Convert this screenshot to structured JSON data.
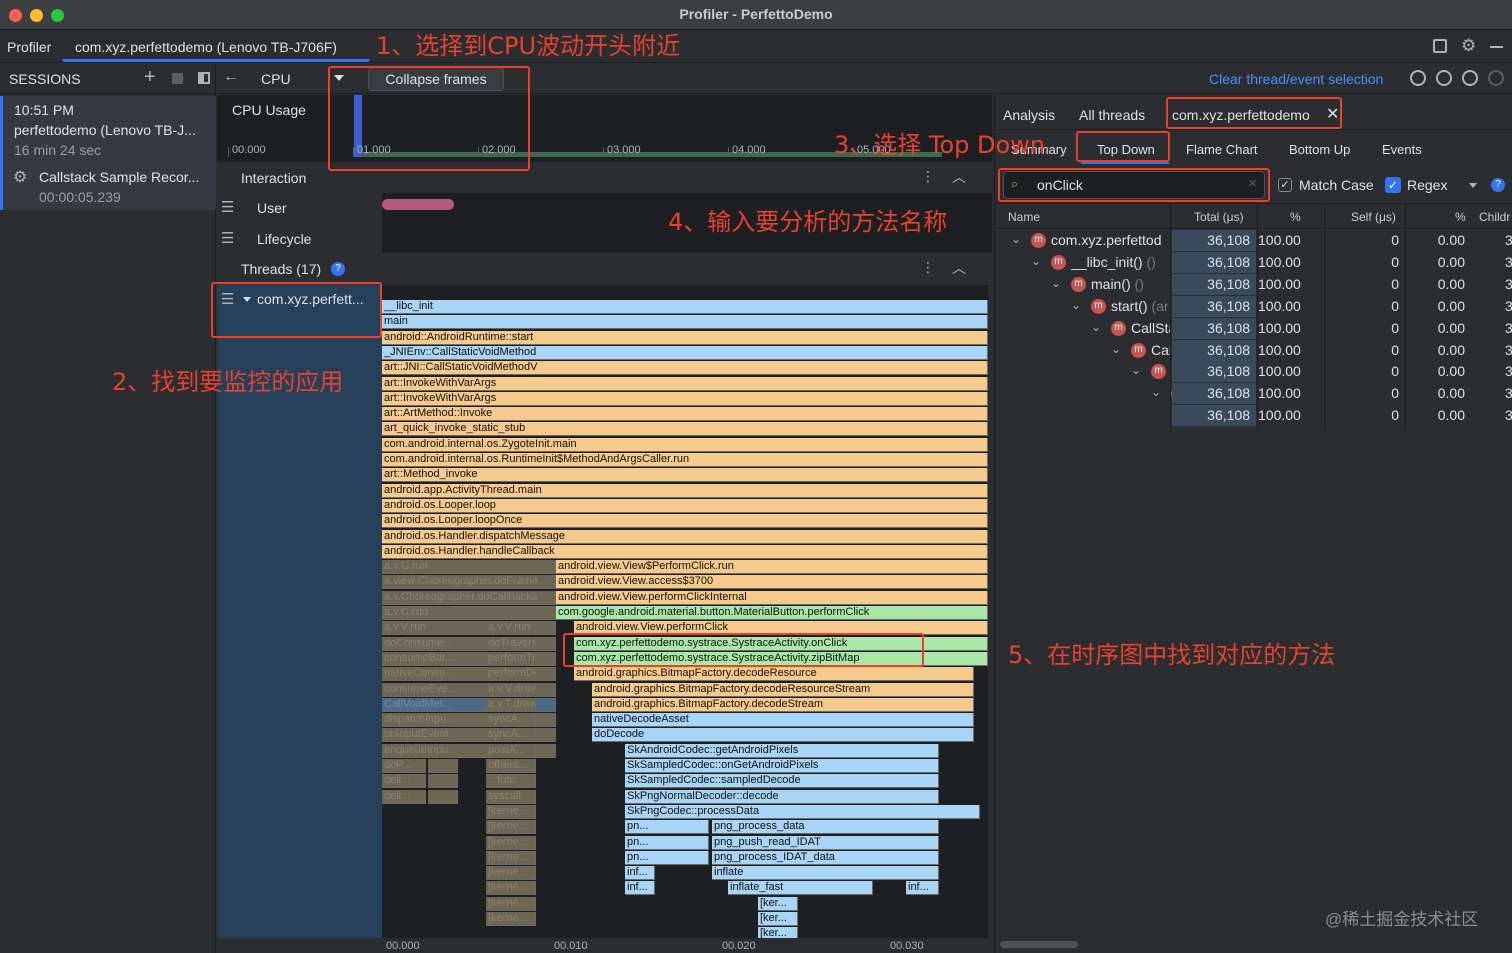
{
  "window": {
    "title": "Profiler - PerfettoDemo"
  },
  "tabs": {
    "profiler": "Profiler",
    "session": "com.xyz.perfettodemo (Lenovo TB-J706F)"
  },
  "sessions": {
    "header": "SESSIONS",
    "time": "10:51 PM",
    "name": "perfettodemo (Lenovo TB-J...",
    "duration": "16 min 24 sec",
    "record_name": "Callstack Sample Recor...",
    "record_time": "00:00:05.239"
  },
  "toolbar": {
    "cpu": "CPU",
    "collapse": "Collapse frames",
    "clear": "Clear thread/event selection"
  },
  "cpu_track": {
    "label": "CPU Usage",
    "ticks": [
      "00.000",
      "01.000",
      "02.000",
      "03.000",
      "04.000",
      "05.000"
    ]
  },
  "interaction": {
    "header": "Interaction",
    "user": "User",
    "lifecycle": "Lifecycle"
  },
  "threads": {
    "header": "Threads (17)",
    "thread_name": "com.xyz.perfett..."
  },
  "flame_ticks": [
    "00.000",
    "00.010",
    "00.020",
    "00.030"
  ],
  "flame": {
    "full_rows": [
      {
        "label": "__libc_init",
        "color": "blue"
      },
      {
        "label": "main",
        "color": "blue"
      },
      {
        "label": "android::AndroidRuntime::start",
        "color": "orange"
      },
      {
        "label": "_JNIEnv::CallStaticVoidMethod",
        "color": "blue"
      },
      {
        "label": "art::JNI::CallStaticVoidMethodV",
        "color": "orange"
      },
      {
        "label": "art::InvokeWithVarArgs",
        "color": "orange"
      },
      {
        "label": "art::InvokeWithVarArgs",
        "color": "orange"
      },
      {
        "label": "art::ArtMethod::Invoke",
        "color": "orange"
      },
      {
        "label": "art_quick_invoke_static_stub",
        "color": "orange"
      },
      {
        "label": "com.android.internal.os.ZygoteInit.main",
        "color": "orange"
      },
      {
        "label": "com.android.internal.os.RuntimeInit$MethodAndArgsCaller.run",
        "color": "orange"
      },
      {
        "label": "art::Method_invoke",
        "color": "orange"
      },
      {
        "label": "android.app.ActivityThread.main",
        "color": "orange"
      },
      {
        "label": "android.os.Looper.loop",
        "color": "orange"
      },
      {
        "label": "android.os.Looper.loopOnce",
        "color": "orange"
      },
      {
        "label": "android.os.Handler.dispatchMessage",
        "color": "orange"
      },
      {
        "label": "android.os.Handler.handleCallback",
        "color": "orange"
      }
    ],
    "left_dim": [
      "a.v.C.run",
      "a.view.Choreographer.doFrame",
      "a.v.Choreographer.doCallbacks",
      "a.v.C.run",
      "a.v.V.run",
      "doConsume...",
      "consumeBat...",
      "nativeConsu...",
      "consumeEve...",
      "CallVoidMet...",
      "dispatchInpu...",
      "onInputEvent",
      "enqueueInpu...",
      "doP...",
      "deli...",
      "deli..."
    ],
    "mid_dim": [
      "a.v.V.run",
      "doTraversal",
      "performTr...",
      "performDr...",
      "a.v.V.draw",
      "a.v.T.draw",
      "syncA...",
      "syncA...",
      "postA...",
      "others...",
      "...fute",
      "syscall",
      "[kerne...",
      "[kerne...",
      "[kerne...",
      "[kerne...",
      "[kerne...",
      "[kerne...",
      "[kerne...",
      "[kerne..."
    ],
    "mid_rows": [
      {
        "label": "android.view.View$PerformClick.run",
        "color": "orange"
      },
      {
        "label": "android.view.View.access$3700",
        "color": "orange"
      },
      {
        "label": "android.view.View.performClickInternal",
        "color": "orange"
      },
      {
        "label": "com.google.android.material.button.MaterialButton.performClick",
        "color": "green"
      },
      {
        "label": "android.view.View.performClick",
        "color": "orange"
      },
      {
        "label": "com.xyz.perfettodemo.systrace.SystraceActivity.onClick",
        "color": "green"
      },
      {
        "label": "com.xyz.perfettodemo.systrace.SystraceActivity.zipBitMap",
        "color": "green"
      },
      {
        "label": "android.graphics.BitmapFactory.decodeResource",
        "color": "orange"
      },
      {
        "label": "android.graphics.BitmapFactory.decodeResourceStream",
        "color": "orange"
      },
      {
        "label": "android.graphics.BitmapFactory.decodeStream",
        "color": "orange"
      },
      {
        "label": "nativeDecodeAsset",
        "color": "blue"
      },
      {
        "label": "doDecode",
        "color": "blue"
      },
      {
        "label": "SkAndroidCodec::getAndroidPixels",
        "color": "blue"
      },
      {
        "label": "SkSampledCodec::onGetAndroidPixels",
        "color": "blue"
      },
      {
        "label": "SkSampledCodec::sampledDecode",
        "color": "blue"
      },
      {
        "label": "SkPngNormalDecoder::decode",
        "color": "blue"
      },
      {
        "label": "SkPngCodec::processData",
        "color": "blue"
      }
    ],
    "deep": {
      "pn1": "pn...",
      "pn2": "pn...",
      "pn3": "pn...",
      "inf1": "inf...",
      "inf2": "inf...",
      "png_process_data": "png_process_data",
      "png_push_read_IDAT": "png_push_read_IDAT",
      "png_process_IDAT_data": "png_process_IDAT_data",
      "inflate": "inflate",
      "inflate_fast": "inflate_fast",
      "inf3": "inf...",
      "ker1": "[ker...",
      "ker2": "[ker...",
      "ker3": "[ker..."
    }
  },
  "right": {
    "tabs": {
      "analysis": "Analysis",
      "all_threads": "All threads",
      "thread": "com.xyz.perfettodemo"
    },
    "subtabs": {
      "summary": "Summary",
      "top_down": "Top Down",
      "flame_chart": "Flame Chart",
      "bottom_up": "Bottom Up",
      "events": "Events"
    },
    "search": {
      "value": "onClick",
      "match_case": "Match Case",
      "regex": "Regex"
    },
    "columns": {
      "name": "Name",
      "total": "Total (μs)",
      "pct": "%",
      "self": "Self (μs)",
      "pct2": "%",
      "children": "Childr"
    },
    "rows": [
      {
        "name": "com.xyz.perfettod",
        "sub": "",
        "total": "36,108",
        "pct": "100.00",
        "self": "0",
        "pct2": "0.00",
        "ch": "3"
      },
      {
        "name": "__libc_init()",
        "sub": " ()",
        "total": "36,108",
        "pct": "100.00",
        "self": "0",
        "pct2": "0.00",
        "ch": "3"
      },
      {
        "name": "main()",
        "sub": " ()",
        "total": "36,108",
        "pct": "100.00",
        "self": "0",
        "pct2": "0.00",
        "ch": "3"
      },
      {
        "name": "start()",
        "sub": " (ar",
        "total": "36,108",
        "pct": "100.00",
        "self": "0",
        "pct2": "0.00",
        "ch": "3"
      },
      {
        "name": "CallSta",
        "sub": "",
        "total": "36,108",
        "pct": "100.00",
        "self": "0",
        "pct2": "0.00",
        "ch": "3"
      },
      {
        "name": "Call",
        "sub": "",
        "total": "36,108",
        "pct": "100.00",
        "self": "0",
        "pct2": "0.00",
        "ch": "3"
      },
      {
        "name": "I",
        "sub": "",
        "total": "36,108",
        "pct": "100.00",
        "self": "0",
        "pct2": "0.00",
        "ch": "3"
      },
      {
        "name": "",
        "sub": "",
        "total": "36,108",
        "pct": "100.00",
        "self": "0",
        "pct2": "0.00",
        "ch": "3"
      },
      {
        "name": "",
        "sub": "",
        "total": "36,108",
        "pct": "100.00",
        "self": "0",
        "pct2": "0.00",
        "ch": "3"
      }
    ]
  },
  "annotations": {
    "a1": "1、选择到CPU波动开头附近",
    "a2": "2、找到要监控的应用",
    "a3": "3、选择 Top Down",
    "a4": "4、输入要分析的方法名称",
    "a5": "5、在时序图中找到对应的方法"
  },
  "watermark": "@稀土掘金技术社区",
  "colors": {
    "accent": "#3574f0",
    "annotation": "#e8412c",
    "flame_blue": "#a8d4f5",
    "flame_orange": "#f6c98c",
    "flame_green": "#a9e8a6"
  }
}
